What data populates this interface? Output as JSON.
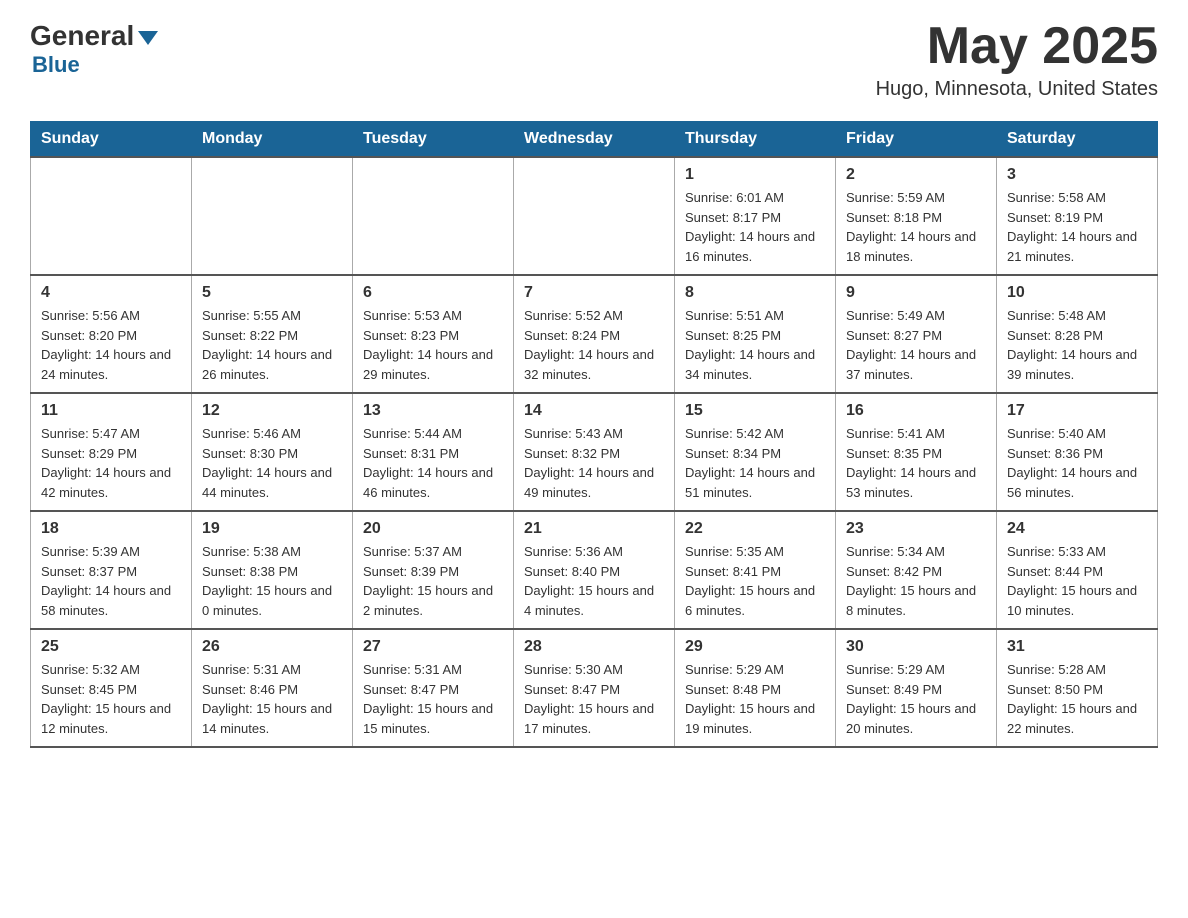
{
  "header": {
    "logo_general": "General",
    "logo_blue": "Blue",
    "month_year": "May 2025",
    "location": "Hugo, Minnesota, United States"
  },
  "weekdays": [
    "Sunday",
    "Monday",
    "Tuesday",
    "Wednesday",
    "Thursday",
    "Friday",
    "Saturday"
  ],
  "weeks": [
    [
      {
        "day": "",
        "info": ""
      },
      {
        "day": "",
        "info": ""
      },
      {
        "day": "",
        "info": ""
      },
      {
        "day": "",
        "info": ""
      },
      {
        "day": "1",
        "info": "Sunrise: 6:01 AM\nSunset: 8:17 PM\nDaylight: 14 hours and 16 minutes."
      },
      {
        "day": "2",
        "info": "Sunrise: 5:59 AM\nSunset: 8:18 PM\nDaylight: 14 hours and 18 minutes."
      },
      {
        "day": "3",
        "info": "Sunrise: 5:58 AM\nSunset: 8:19 PM\nDaylight: 14 hours and 21 minutes."
      }
    ],
    [
      {
        "day": "4",
        "info": "Sunrise: 5:56 AM\nSunset: 8:20 PM\nDaylight: 14 hours and 24 minutes."
      },
      {
        "day": "5",
        "info": "Sunrise: 5:55 AM\nSunset: 8:22 PM\nDaylight: 14 hours and 26 minutes."
      },
      {
        "day": "6",
        "info": "Sunrise: 5:53 AM\nSunset: 8:23 PM\nDaylight: 14 hours and 29 minutes."
      },
      {
        "day": "7",
        "info": "Sunrise: 5:52 AM\nSunset: 8:24 PM\nDaylight: 14 hours and 32 minutes."
      },
      {
        "day": "8",
        "info": "Sunrise: 5:51 AM\nSunset: 8:25 PM\nDaylight: 14 hours and 34 minutes."
      },
      {
        "day": "9",
        "info": "Sunrise: 5:49 AM\nSunset: 8:27 PM\nDaylight: 14 hours and 37 minutes."
      },
      {
        "day": "10",
        "info": "Sunrise: 5:48 AM\nSunset: 8:28 PM\nDaylight: 14 hours and 39 minutes."
      }
    ],
    [
      {
        "day": "11",
        "info": "Sunrise: 5:47 AM\nSunset: 8:29 PM\nDaylight: 14 hours and 42 minutes."
      },
      {
        "day": "12",
        "info": "Sunrise: 5:46 AM\nSunset: 8:30 PM\nDaylight: 14 hours and 44 minutes."
      },
      {
        "day": "13",
        "info": "Sunrise: 5:44 AM\nSunset: 8:31 PM\nDaylight: 14 hours and 46 minutes."
      },
      {
        "day": "14",
        "info": "Sunrise: 5:43 AM\nSunset: 8:32 PM\nDaylight: 14 hours and 49 minutes."
      },
      {
        "day": "15",
        "info": "Sunrise: 5:42 AM\nSunset: 8:34 PM\nDaylight: 14 hours and 51 minutes."
      },
      {
        "day": "16",
        "info": "Sunrise: 5:41 AM\nSunset: 8:35 PM\nDaylight: 14 hours and 53 minutes."
      },
      {
        "day": "17",
        "info": "Sunrise: 5:40 AM\nSunset: 8:36 PM\nDaylight: 14 hours and 56 minutes."
      }
    ],
    [
      {
        "day": "18",
        "info": "Sunrise: 5:39 AM\nSunset: 8:37 PM\nDaylight: 14 hours and 58 minutes."
      },
      {
        "day": "19",
        "info": "Sunrise: 5:38 AM\nSunset: 8:38 PM\nDaylight: 15 hours and 0 minutes."
      },
      {
        "day": "20",
        "info": "Sunrise: 5:37 AM\nSunset: 8:39 PM\nDaylight: 15 hours and 2 minutes."
      },
      {
        "day": "21",
        "info": "Sunrise: 5:36 AM\nSunset: 8:40 PM\nDaylight: 15 hours and 4 minutes."
      },
      {
        "day": "22",
        "info": "Sunrise: 5:35 AM\nSunset: 8:41 PM\nDaylight: 15 hours and 6 minutes."
      },
      {
        "day": "23",
        "info": "Sunrise: 5:34 AM\nSunset: 8:42 PM\nDaylight: 15 hours and 8 minutes."
      },
      {
        "day": "24",
        "info": "Sunrise: 5:33 AM\nSunset: 8:44 PM\nDaylight: 15 hours and 10 minutes."
      }
    ],
    [
      {
        "day": "25",
        "info": "Sunrise: 5:32 AM\nSunset: 8:45 PM\nDaylight: 15 hours and 12 minutes."
      },
      {
        "day": "26",
        "info": "Sunrise: 5:31 AM\nSunset: 8:46 PM\nDaylight: 15 hours and 14 minutes."
      },
      {
        "day": "27",
        "info": "Sunrise: 5:31 AM\nSunset: 8:47 PM\nDaylight: 15 hours and 15 minutes."
      },
      {
        "day": "28",
        "info": "Sunrise: 5:30 AM\nSunset: 8:47 PM\nDaylight: 15 hours and 17 minutes."
      },
      {
        "day": "29",
        "info": "Sunrise: 5:29 AM\nSunset: 8:48 PM\nDaylight: 15 hours and 19 minutes."
      },
      {
        "day": "30",
        "info": "Sunrise: 5:29 AM\nSunset: 8:49 PM\nDaylight: 15 hours and 20 minutes."
      },
      {
        "day": "31",
        "info": "Sunrise: 5:28 AM\nSunset: 8:50 PM\nDaylight: 15 hours and 22 minutes."
      }
    ]
  ]
}
